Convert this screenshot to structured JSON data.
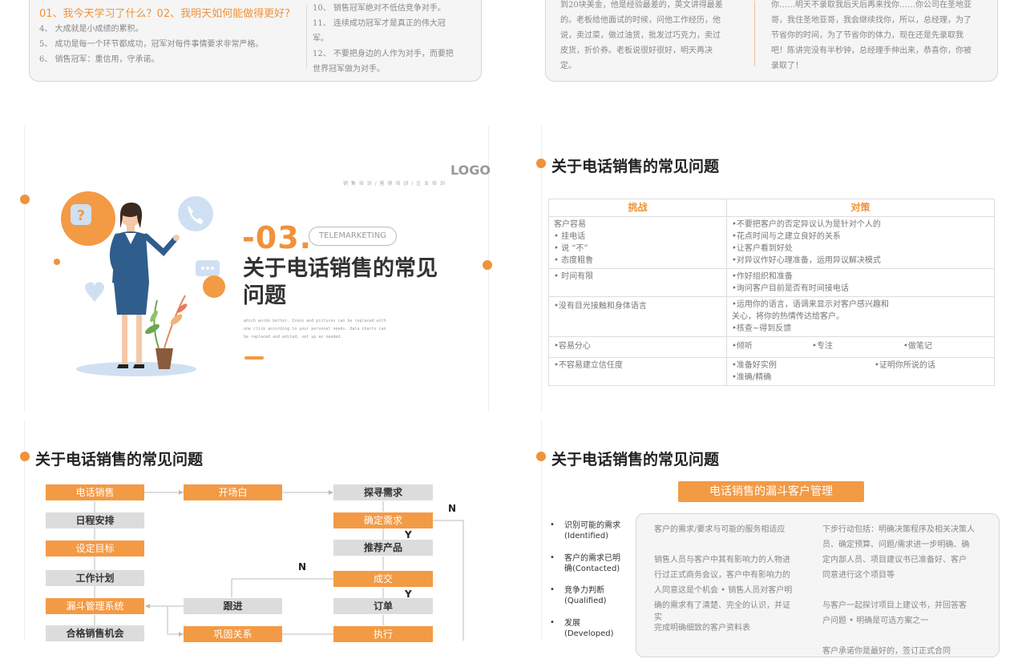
{
  "top_left": {
    "headline": "01、我今天学习了什么？02、我明天如何能做得更好?",
    "left_items": [
      "4、  大成就是小成绩的累积。",
      "5、  成功是每一个环节都成功，冠军对每件事情要求非常严格。",
      "6、  销售冠军：重信用，守承诺。"
    ],
    "right_items": [
      "10、  销售冠军绝对不低估竞争对手。",
      "11、  连续成功冠军才是真正的伟大冠",
      "军。",
      "12、  不要把身边的人作为对手，而要把",
      "世界冠军做为对手。"
    ]
  },
  "top_right": {
    "left_text": [
      "到20块美金，他是经验最差的，英文讲得最差",
      "的。老板给他面试的时候，问他工作经历，他",
      "说，卖过菜，做过油货，批发过巧克力，卖过",
      "皮货，折价券。老板说很好很好，明天再决",
      "定。"
    ],
    "right_text": [
      "你……明天不录取我后天后再来找你……你公司在圣地亚",
      "哥，我住圣地亚哥，我会继续找你，所以，总经理，为了",
      "节省你的时间，为了节省你的体力，现在还是先录取我",
      "吧！陈讲完没有半秒钟，总经理手伸出来，恭喜你，你被",
      "录取了！"
    ]
  },
  "cover": {
    "logo": "LOGO",
    "tagline": "销 售 培 训 / 营 销 培 训 / 企 业 培 训",
    "number": "-03.",
    "tag": "TELEMARKETING",
    "title_line1": "关于电话销售的常见",
    "title_line2": "问题",
    "desc": [
      "which words better. Icons and pictures can be replaced with",
      "one click according to your personal needs. Data charts can",
      "be replaced and edited, set up as needed."
    ],
    "icons": [
      "question-icon",
      "phone-icon",
      "chat-icon",
      "heart-icon"
    ]
  },
  "table_slide": {
    "heading": "关于电话销售的常见问题",
    "col_challenge": "挑战",
    "col_response": "对策",
    "rows": [
      {
        "c": [
          "客户容易",
          "•      挂电话",
          "•      说 “不”",
          "•      态度粗鲁"
        ],
        "r": [
          "•不要把客户的否定异议认为是针对个人的",
          "•花点时间与之建立良好的关系",
          "•让客户看到好处",
          "•对异议作好心理准备，运用异议解决模式"
        ]
      },
      {
        "c": [
          "• 时间有限"
        ],
        "r": [
          "•作好组织和准备",
          "•询问客户目前是否有时间接电话"
        ]
      },
      {
        "c": [
          "•没有目光接触和身体语言"
        ],
        "r": [
          "•运用你的语言，语调来显示对客户感兴趣和",
          "  关心，将你的热情传达给客户。",
          "•核查~得到反馈"
        ]
      },
      {
        "c": [
          "•容易分心"
        ],
        "r3": [
          "•倾听",
          "•专注",
          "•做笔记"
        ]
      },
      {
        "c": [
          "•不容易建立信任度"
        ],
        "r2": [
          "•准备好实例",
          "•证明你所说的话"
        ],
        "r_extra": "•准确/精确"
      }
    ]
  },
  "flow_slide": {
    "heading": "关于电话销售的常见问题",
    "left_col": [
      "电话销售",
      "日程安排",
      "设定目标",
      "工作计划",
      "漏斗管理系统",
      "合格销售机会"
    ],
    "mid_col": [
      "开场白",
      "跟进",
      "巩固关系"
    ],
    "right_col": [
      "探寻需求",
      "确定需求",
      "推荐产品",
      "成交",
      "订单",
      "执行"
    ],
    "labels": {
      "n1": "N",
      "y1": "Y",
      "n2": "N",
      "y2": "Y"
    }
  },
  "funnel_slide": {
    "heading": "关于电话销售的常见问题",
    "title": "电话销售的漏斗客户管理",
    "stages": [
      {
        "l1": "识别可能的需求",
        "l2": "(Identified)"
      },
      {
        "l1": "客户的需求已明",
        "l2": "确(Contacted)"
      },
      {
        "l1": "竞争力判断",
        "l2": "(Qualified)"
      },
      {
        "l1": "发展",
        "l2": "(Developed)"
      }
    ],
    "middle_text": [
      "客户的需求/要求与可能的服务相适应",
      "",
      "销售人员与客户中其有影响力的人物进",
      "行过正式商务会议，客户中有影响力的",
      "人同意这是个机会 • 销售人员对客户明",
      "确的需求有了清楚、完全的认识，并证",
      "实",
      "完成明确细致的客户资料表"
    ],
    "right_text": [
      "下步行动包括：明确决策程序及相关决策人",
      "员、确定预算、问题/需求进一步明确、确",
      "定内部人员、项目建议书已准备好、客户",
      "同意进行这个项目等",
      "",
      "与客户一起探讨项目上建议书，并回答客",
      "户问题 • 明确是可选方案之一",
      "",
      "客户承诺你是最好的，签订正式合同"
    ]
  }
}
